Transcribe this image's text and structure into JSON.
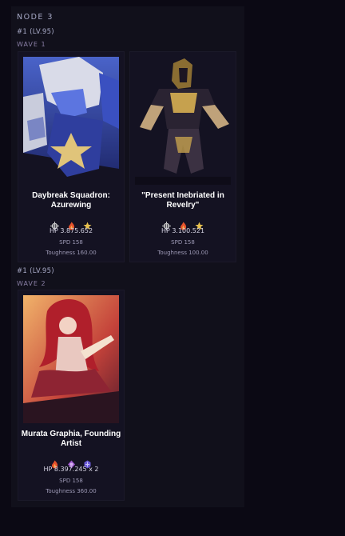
{
  "node_title": "NODE 3",
  "waves": [
    {
      "level": "#1 (LV.95)",
      "wave_label": "WAVE 1",
      "enemies": [
        {
          "name": "Daybreak Squadron: Azurewing",
          "hp": "HP 3.875.652",
          "spd": "SPD 158",
          "toughness": "Toughness 160.00",
          "weaknesses": [
            "physical-icon",
            "fire-icon",
            "imaginary-icon"
          ]
        },
        {
          "name": "\"Present Inebriated in Revelry\"",
          "hp": "HP 3.100.521",
          "spd": "SPD 158",
          "toughness": "Toughness 100.00",
          "weaknesses": [
            "physical-icon",
            "fire-icon",
            "imaginary-icon"
          ]
        }
      ]
    },
    {
      "level": "#1 (LV.95)",
      "wave_label": "WAVE 2",
      "enemies": [
        {
          "name": "Murata Graphia, Founding Artist",
          "hp": "HP 8.397.245 x 2",
          "spd": "SPD 158",
          "toughness": "Toughness 360.00",
          "weaknesses": [
            "fire-icon",
            "wind-icon",
            "quantum-icon"
          ]
        }
      ]
    }
  ]
}
